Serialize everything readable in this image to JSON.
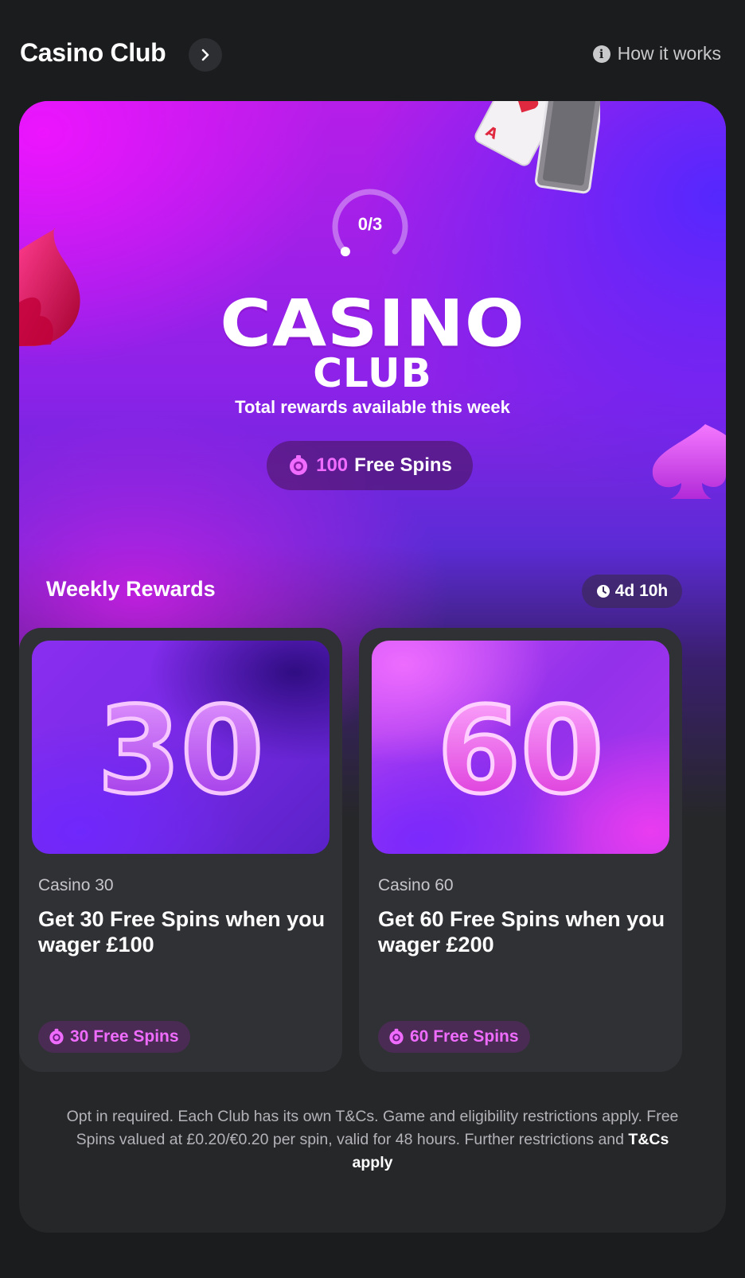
{
  "header": {
    "title": "Casino Club",
    "how_it_works": "How it works"
  },
  "hero": {
    "progress": "0/3",
    "progress_fraction": 0,
    "logo_line1": "CASINO",
    "logo_line2": "CLUB",
    "caption": "Total rewards available this week",
    "total_amount": "100",
    "total_unit": "Free Spins"
  },
  "weekly": {
    "title": "Weekly Rewards",
    "timer": "4d 10h"
  },
  "rewards": [
    {
      "number": "30",
      "category": "Casino 30",
      "description": "Get 30 Free Spins when you wager £100",
      "spins": "30 Free Spins"
    },
    {
      "number": "60",
      "category": "Casino 60",
      "description": "Get 60 Free Spins when you wager £200",
      "spins": "60 Free Spins"
    }
  ],
  "disclaimer": {
    "text": "Opt in required. Each Club has its own T&Cs. Game and eligibility restrictions apply. Free Spins valued at £0.20/€0.20 per spin, valid for 48 hours. Further restrictions and ",
    "link": "T&Cs apply"
  },
  "colors": {
    "accent_pink": "#f06cff",
    "background": "#1b1c1e",
    "card": "#303135"
  },
  "icons": [
    "chevron-right-icon",
    "info-icon",
    "chip-icon",
    "clock-icon",
    "flame-icon",
    "spade-icon",
    "playing-cards-icon"
  ]
}
